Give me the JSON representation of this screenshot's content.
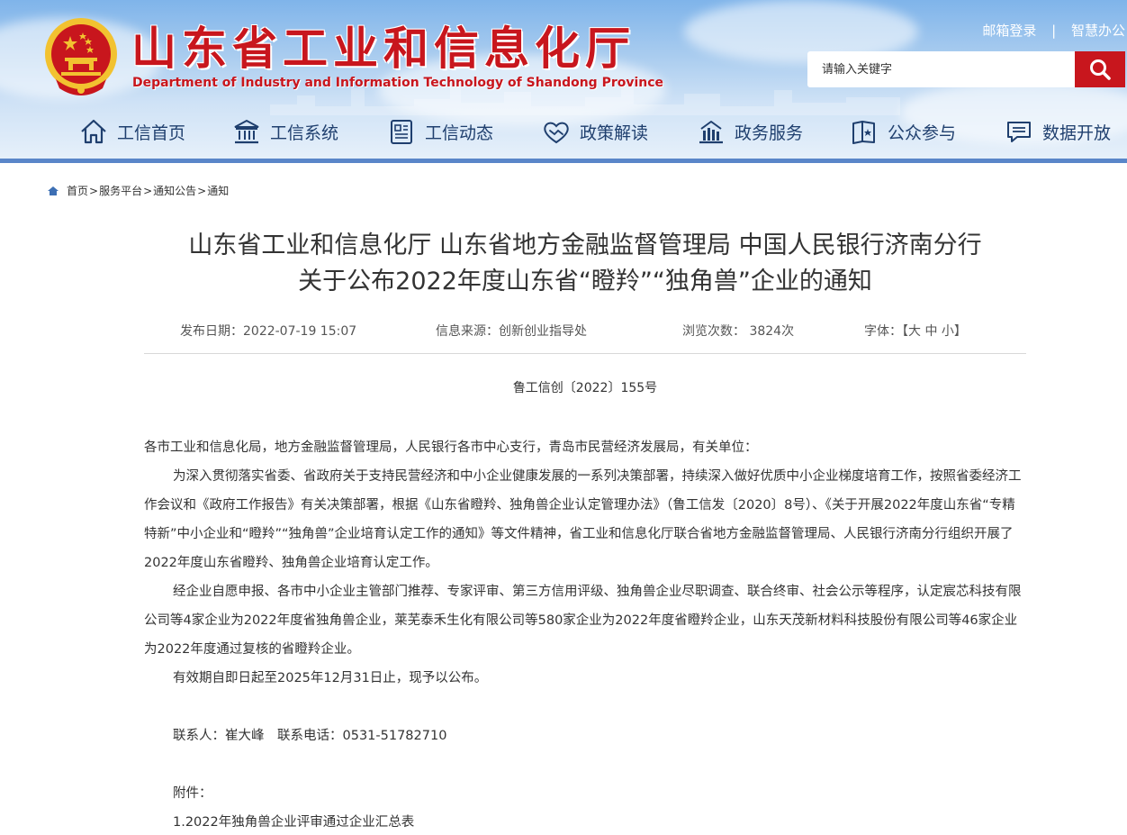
{
  "header": {
    "site_title": "山东省工业和信息化厅",
    "site_subtitle": "Department of Industry and Information Technology of Shandong Province",
    "top_links": [
      "邮箱登录",
      "智慧办公"
    ],
    "top_link_separator": "|",
    "search_placeholder": "请输入关键字",
    "brand_color": "#c8161d",
    "nav_bar_color": "#5a86c9"
  },
  "nav": [
    {
      "label": "工信首页",
      "icon": "home-icon"
    },
    {
      "label": "工信系统",
      "icon": "building-icon"
    },
    {
      "label": "工信动态",
      "icon": "news-icon"
    },
    {
      "label": "政策解读",
      "icon": "handshake-icon"
    },
    {
      "label": "政务服务",
      "icon": "service-icon"
    },
    {
      "label": "公众参与",
      "icon": "book-icon"
    },
    {
      "label": "数据开放",
      "icon": "chat-icon"
    }
  ],
  "breadcrumb": {
    "icon": "home-icon",
    "items": [
      "首页",
      "服务平台",
      "通知公告",
      "通知"
    ],
    "separator": ">"
  },
  "article": {
    "title_line1": "山东省工业和信息化厅 山东省地方金融监督管理局 中国人民银行济南分行",
    "title_line2": "关于公布2022年度山东省“瞪羚”“独角兽”企业的通知",
    "meta": {
      "date": "发布日期：2022-07-19 15:07",
      "source": "信息来源：创新创业指导处",
      "views": "浏览次数： 3824次",
      "font_size": "字体：【大 中 小】"
    },
    "doc_number": "鲁工信创〔2022〕155号",
    "salutation": "各市工业和信息化局，地方金融监督管理局，人民银行各市中心支行，青岛市民营经济发展局，有关单位：",
    "para1": "为深入贯彻落实省委、省政府关于支持民营经济和中小企业健康发展的一系列决策部署，持续深入做好优质中小企业梯度培育工作，按照省委经济工作会议和《政府工作报告》有关决策部署，根据《山东省瞪羚、独角兽企业认定管理办法》（鲁工信发〔2020〕8号）、《关于开展2022年度山东省“专精特新”中小企业和“瞪羚”“独角兽”企业培育认定工作的通知》等文件精神，省工业和信息化厅联合省地方金融监督管理局、人民银行济南分行组织开展了2022年度山东省瞪羚、独角兽企业培育认定工作。",
    "para2": "经企业自愿申报、各市中小企业主管部门推荐、专家评审、第三方信用评级、独角兽企业尽职调查、联合终审、社会公示等程序，认定宸芯科技有限公司等4家企业为2022年度省独角兽企业，莱芜泰禾生化有限公司等580家企业为2022年度省瞪羚企业，山东天茂新材料科技股份有限公司等46家企业为2022年度通过复核的省瞪羚企业。",
    "para3": "有效期自即日起至2025年12月31日止，现予以公布。",
    "contact": "联系人：崔大峰　联系电话：0531-51782710",
    "attachment_label": "附件：",
    "attachment_1": "1.2022年独角兽企业评审通过企业汇总表"
  }
}
